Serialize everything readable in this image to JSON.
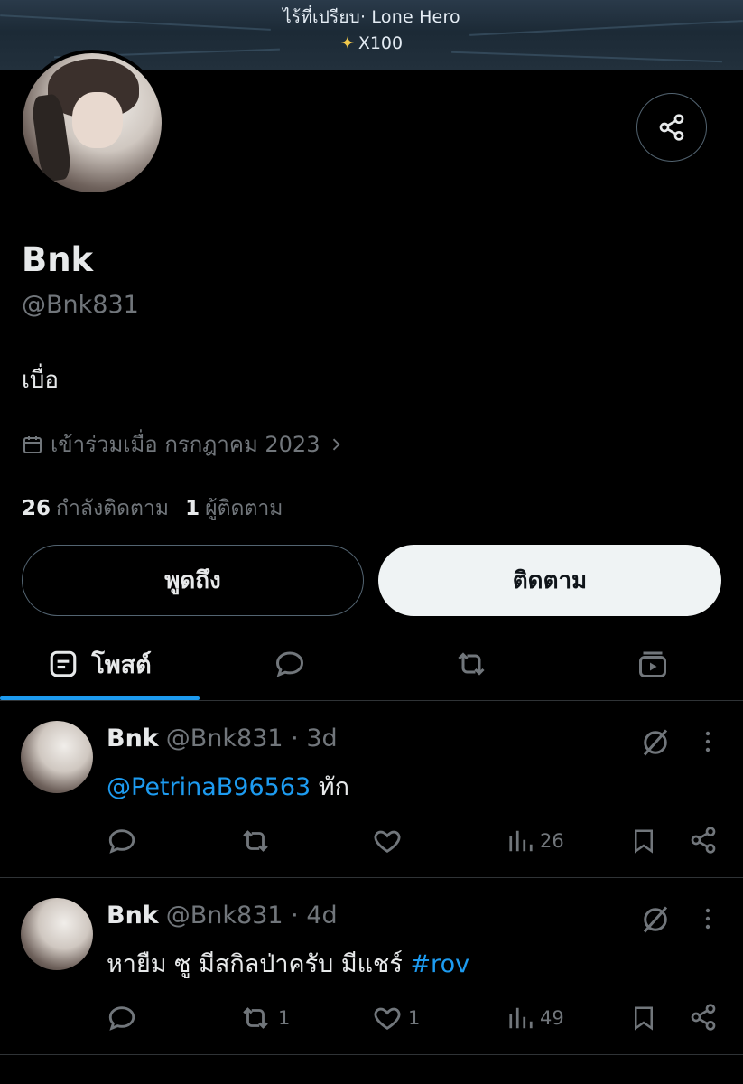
{
  "banner": {
    "caption": "ไร้ที่เปรียบ· Lone Hero",
    "reward": "X100"
  },
  "profile": {
    "name": "Bnk",
    "handle": "@Bnk831",
    "bio": "เบื่อ",
    "joined": "เข้าร่วมเมื่อ กรกฎาคม 2023",
    "following_count": "26",
    "following_label": "กำลังติดตาม",
    "followers_count": "1",
    "followers_label": "ผู้ติดตาม"
  },
  "buttons": {
    "mention": "พูดถึง",
    "follow": "ติดตาม"
  },
  "tabs": {
    "posts": "โพสต์"
  },
  "posts": [
    {
      "name": "Bnk",
      "handle": "@Bnk831",
      "time": "· 3d",
      "mention": "@PetrinaB96563",
      "text": " ทัก",
      "reposts": "",
      "likes": "",
      "views": "26"
    },
    {
      "name": "Bnk",
      "handle": "@Bnk831",
      "time": "· 4d",
      "text": "หายืม ซู มีสกิลป่าครับ มีแชร์ ",
      "hashtag": "#rov",
      "reposts": "1",
      "likes": "1",
      "views": "49"
    }
  ],
  "icons": {
    "share": "share-icon",
    "calendar": "calendar-icon",
    "chevron": "chevron-right-icon",
    "posts_tab": "posts-tab-icon",
    "replies_tab": "reply-icon",
    "reposts_tab": "repost-icon",
    "media_tab": "media-icon",
    "grok": "grok-icon",
    "more": "more-vertical-icon",
    "like": "heart-icon",
    "views": "views-icon",
    "bookmark": "bookmark-icon"
  },
  "colors": {
    "background": "#000000",
    "accent": "#1d9bf0",
    "muted": "#71767b",
    "text": "#e7e9ea",
    "follow_button": "#eff3f4"
  }
}
